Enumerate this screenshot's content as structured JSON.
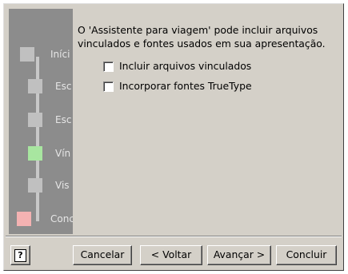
{
  "description": "O 'Assistente para viagem' pode incluir arquivos vinculados e fontes usados em sua apresentação.",
  "options": [
    {
      "label": "Incluir arquivos vinculados",
      "checked": false
    },
    {
      "label": "Incorporar fontes TrueType",
      "checked": false
    }
  ],
  "steps": [
    {
      "label": "Iníci",
      "color": "#c0c0c0"
    },
    {
      "label": "Esc",
      "color": "#c0c0c0"
    },
    {
      "label": "Esc",
      "color": "#c0c0c0"
    },
    {
      "label": "Vín",
      "color": "#a8e6a0"
    },
    {
      "label": "Vis",
      "color": "#c0c0c0"
    },
    {
      "label": "Conc",
      "color": "#f4b2b2"
    }
  ],
  "buttons": {
    "help_icon": "?",
    "cancel": "Cancelar",
    "back": "< Voltar",
    "next": "Avançar >",
    "finish": "Concluir"
  }
}
